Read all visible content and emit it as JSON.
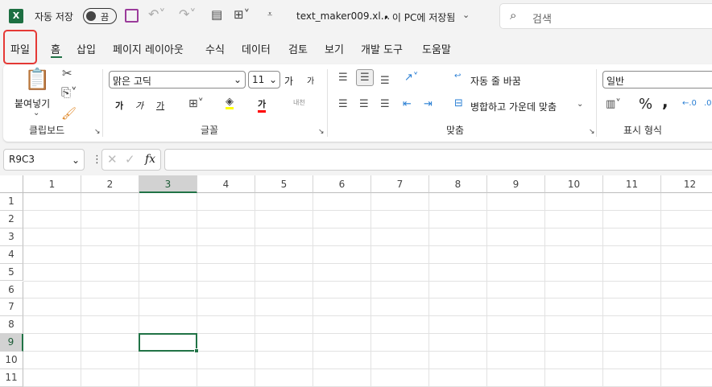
{
  "titlebar": {
    "autosave_label": "자동 저장",
    "autosave_state": "끔",
    "filename": "text_maker009.xl...",
    "save_status": "• 이 PC에 저장됨",
    "search_placeholder": "검색"
  },
  "tabs": [
    {
      "label": "파일",
      "highlighted": true
    },
    {
      "label": "홈",
      "active": true
    },
    {
      "label": "삽입"
    },
    {
      "label": "페이지 레이아웃"
    },
    {
      "label": "수식"
    },
    {
      "label": "데이터"
    },
    {
      "label": "검토"
    },
    {
      "label": "보기"
    },
    {
      "label": "개발 도구"
    },
    {
      "label": "도움말"
    }
  ],
  "ribbon": {
    "clipboard": {
      "paste": "붙여넣기",
      "group": "클립보드"
    },
    "font": {
      "name": "맑은 고딕",
      "size": "11",
      "grow": "가",
      "shrink": "가",
      "bold": "가",
      "italic": "가",
      "underline": "가",
      "color_a": "가",
      "phonetic": "내천",
      "group": "글꼴",
      "highlight_color": "#ffff00",
      "font_color": "#ff0000"
    },
    "alignment": {
      "wrap": "자동 줄 바꿈",
      "merge": "병합하고 가운데 맞춤",
      "group": "맞춤"
    },
    "number": {
      "format": "일반",
      "percent": "%",
      "comma": ",",
      "group": "표시 형식"
    }
  },
  "formula_bar": {
    "name_box": "R9C3",
    "fx": "fx",
    "value": ""
  },
  "columns": [
    "1",
    "2",
    "3",
    "4",
    "5",
    "6",
    "7",
    "8",
    "9",
    "10",
    "11",
    "12"
  ],
  "rows": [
    "1",
    "2",
    "3",
    "4",
    "5",
    "6",
    "7",
    "8",
    "9",
    "10",
    "11"
  ],
  "selected": {
    "row": 9,
    "col": 3
  },
  "accent": "#217346"
}
